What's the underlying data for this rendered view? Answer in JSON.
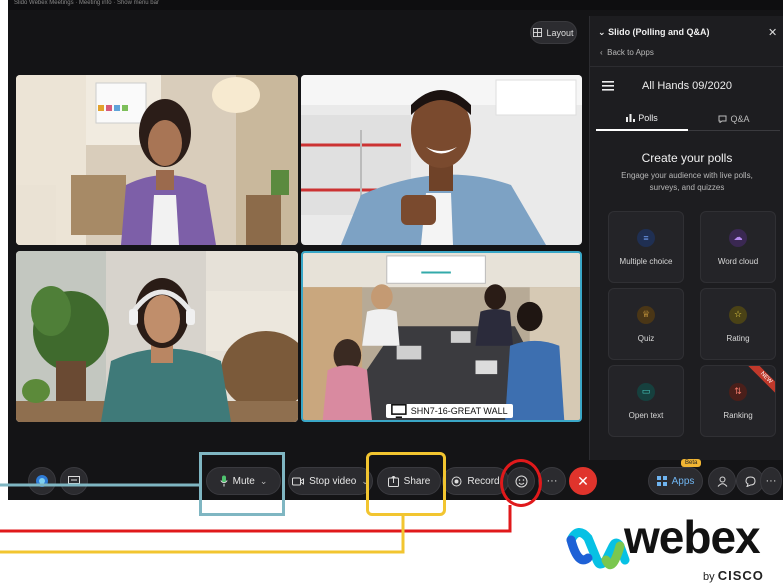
{
  "window": {
    "title_strip": "Slido Webex Meetings · Meeting info · Show menu bar"
  },
  "layout_button": {
    "label": "Layout"
  },
  "video_tiles": [
    {
      "id": "participant-1"
    },
    {
      "id": "participant-2"
    },
    {
      "id": "participant-3"
    },
    {
      "id": "room",
      "label": "SHN7-16-GREAT WALL"
    }
  ],
  "slido_panel": {
    "title": "Slido (Polling and Q&A)",
    "back": "Back to Apps",
    "event_name": "All Hands 09/2020",
    "tabs": [
      {
        "label": "Polls"
      },
      {
        "label": "Q&A"
      }
    ],
    "heading": "Create your polls",
    "subtext": "Engage your audience with live polls, surveys, and quizzes",
    "cards": [
      {
        "label": "Multiple choice",
        "icon": "list-icon",
        "color": "#3b6fd6"
      },
      {
        "label": "Word cloud",
        "icon": "cloud-icon",
        "color": "#8e5bd6"
      },
      {
        "label": "Quiz",
        "icon": "trophy-icon",
        "color": "#e0a02a"
      },
      {
        "label": "Rating",
        "icon": "star-icon",
        "color": "#e0c02a"
      },
      {
        "label": "Open text",
        "icon": "speech-bubble-icon",
        "color": "#2aa7a0"
      },
      {
        "label": "Ranking",
        "icon": "ranking-icon",
        "color": "#d04a3a",
        "badge": "NEW"
      }
    ]
  },
  "controls": {
    "mute": "Mute",
    "stop_video": "Stop video",
    "share": "Share",
    "record": "Record",
    "more": "···",
    "leave": "✕",
    "apps": "Apps",
    "apps_badge": "Beta",
    "panel_more": "···"
  },
  "annotations": {
    "colors": {
      "mute": "#7fb6c2",
      "share": "#f2c530",
      "reactions": "#e0191b"
    }
  },
  "branding": {
    "logo_word": "webex",
    "by": "by",
    "company": "CISCO"
  }
}
